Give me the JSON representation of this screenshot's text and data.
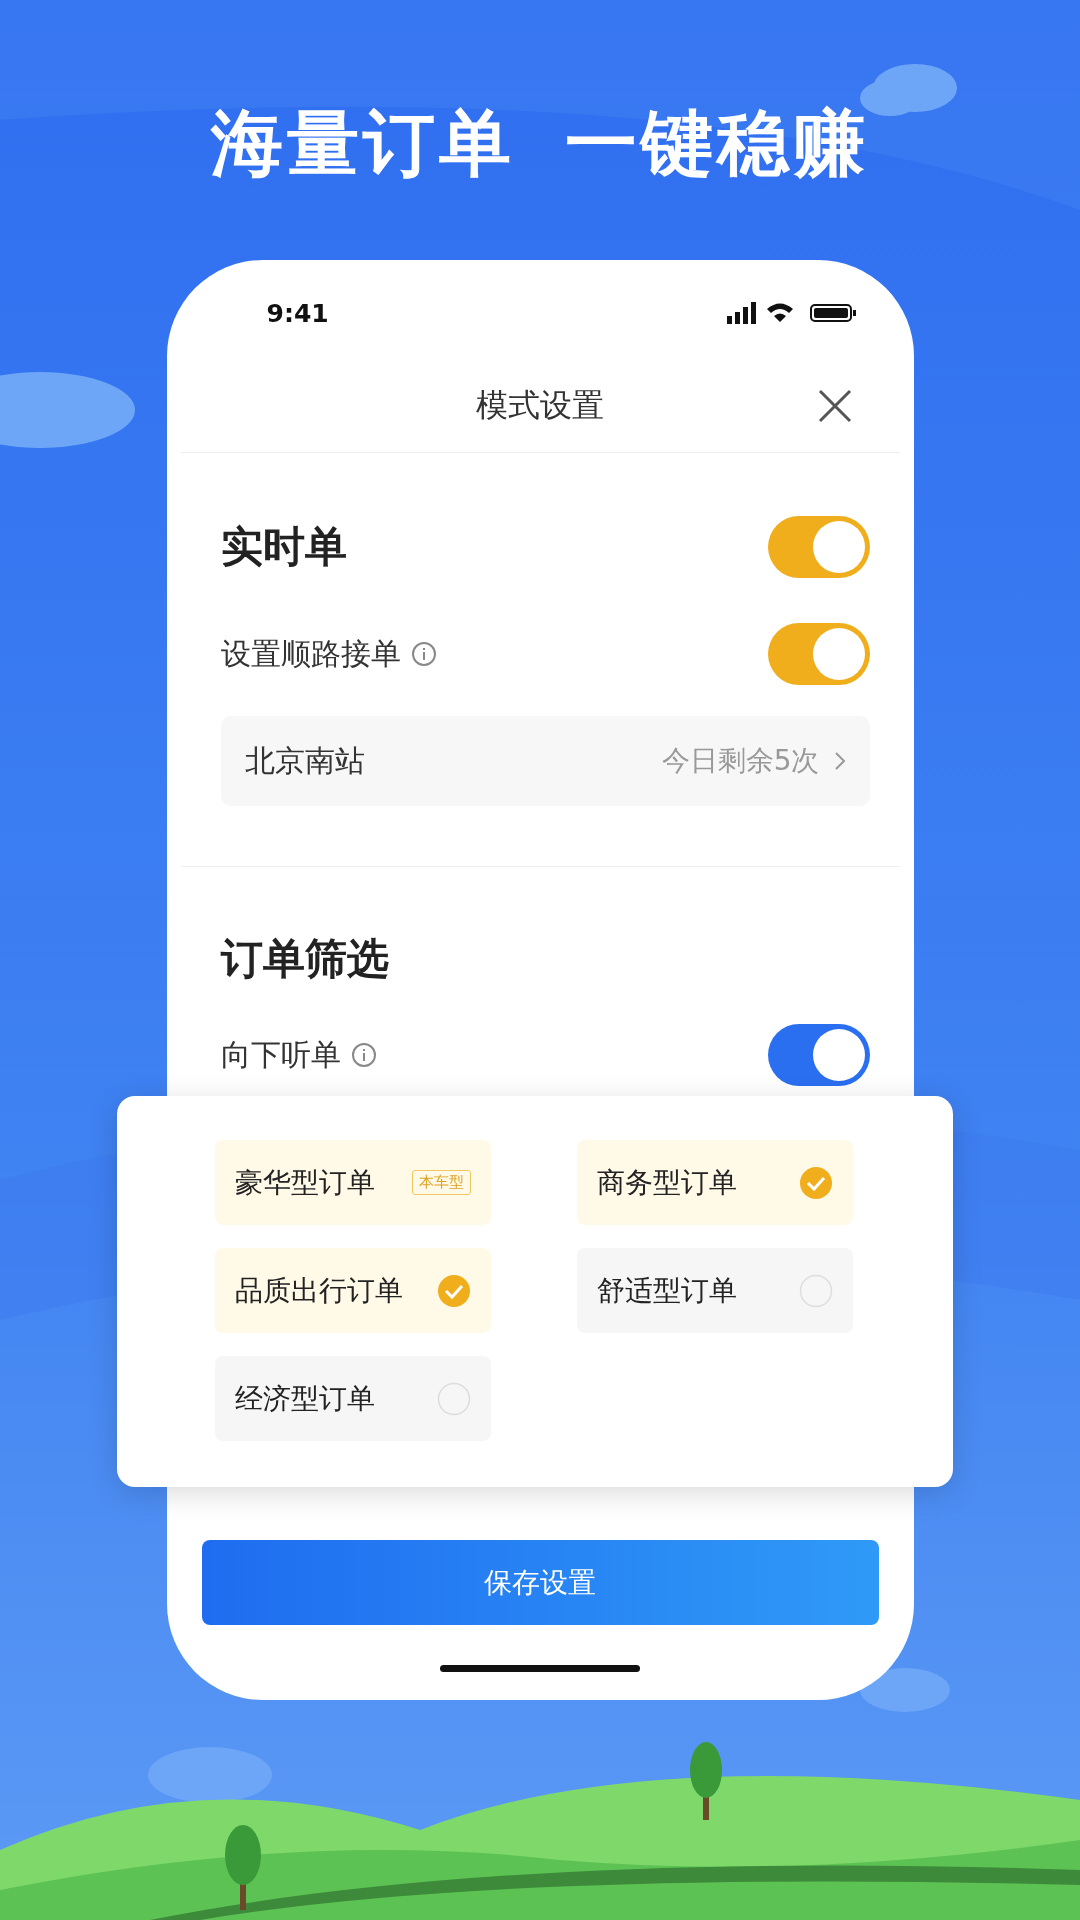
{
  "headline": "海量订单 一键稳赚",
  "status_bar": {
    "time": "9:41"
  },
  "header": {
    "title": "模式设置"
  },
  "realtime": {
    "title": "实时单",
    "on": true
  },
  "route": {
    "label": "设置顺路接单",
    "on": true
  },
  "location": {
    "name": "北京南站",
    "remaining": "今日剩余5次"
  },
  "filter": {
    "title": "订单筛选"
  },
  "listen_down": {
    "label": "向下听单",
    "on": true
  },
  "order_types": [
    {
      "label": "豪华型订单",
      "badge": "本车型",
      "selected": true
    },
    {
      "label": "商务型订单",
      "selected": true
    },
    {
      "label": "品质出行订单",
      "selected": true
    },
    {
      "label": "舒适型订单",
      "selected": false
    },
    {
      "label": "经济型订单",
      "selected": false
    }
  ],
  "save_button": "保存设置"
}
